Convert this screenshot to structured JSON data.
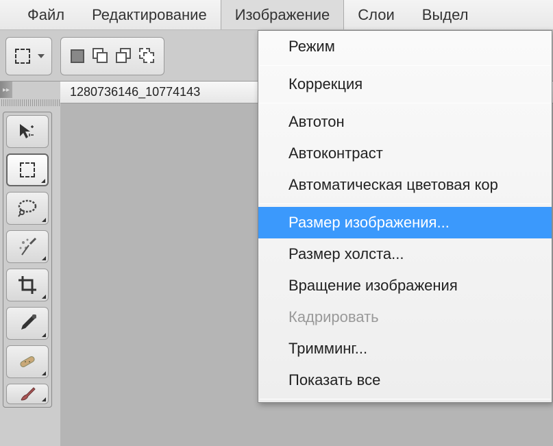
{
  "menubar": {
    "file": "Файл",
    "edit": "Редактирование",
    "image": "Изображение",
    "layers": "Слои",
    "select": "Выдел"
  },
  "dropdown": {
    "mode": "Режим",
    "adjustments": "Коррекция",
    "autoTone": "Автотон",
    "autoContrast": "Автоконтраст",
    "autoColor": "Автоматическая цветовая кор",
    "imageSize": "Размер изображения...",
    "canvasSize": "Размер холста...",
    "imageRotation": "Вращение изображения",
    "crop": "Кадрировать",
    "trim": "Тримминг...",
    "revealAll": "Показать все"
  },
  "document": {
    "tabName": "1280736146_10774143"
  },
  "tools": {
    "move": "move",
    "marquee": "marquee",
    "lasso": "lasso",
    "magicWand": "magic-wand",
    "crop": "crop",
    "eyedropper": "eyedropper",
    "healing": "healing",
    "brush": "brush"
  }
}
